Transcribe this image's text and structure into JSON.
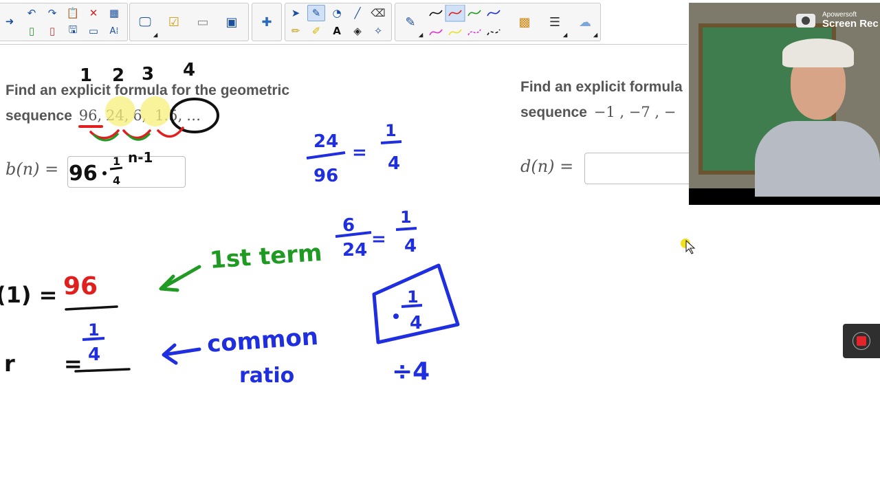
{
  "problem1": {
    "line1": "Find an explicit formula for the geometric",
    "line2_prefix": "sequence",
    "terms": [
      "96",
      "24",
      "6",
      "1.5"
    ],
    "separator": ",",
    "ellipsis": "…",
    "answer_label": "b(n) ="
  },
  "problem2": {
    "line1": "Find an explicit formula",
    "line2_prefix": "sequence",
    "terms_text": "−1 , −7 , −",
    "answer_label": "d(n) ="
  },
  "handwriting": {
    "term_indices": [
      "1",
      "2",
      "3",
      "4"
    ],
    "answer_ink": "96",
    "first_term_lhs": "(1) =",
    "first_term_value": "96",
    "first_term_note": "1st term",
    "ratio_lhs": "r =",
    "ratio_note_1": "common",
    "ratio_note_2": "ratio",
    "divide_note": "÷4"
  },
  "overlay": {
    "brand_line1": "Apowersoft",
    "brand_line2": "Screen Rec"
  },
  "toolbar_icons": {
    "group1": [
      "arrow-right-icon",
      "undo-icon",
      "redo-icon",
      "paste-icon",
      "delete-icon",
      "table-icon",
      "new-page-icon",
      "remove-page-icon",
      "save-icon",
      "screen-icon",
      "text-spell-icon"
    ],
    "group2": [
      "presentation-icon",
      "checklist-icon",
      "capture-icon",
      "lego-icon"
    ],
    "group3": [
      "plugin-icon"
    ],
    "group4": [
      "select-icon",
      "pen-icon",
      "shape-icon",
      "line-icon",
      "eraser-icon",
      "pencil-icon",
      "highlighter-icon",
      "text-tool-icon",
      "fill-icon",
      "magic-wand-icon"
    ],
    "group5": [
      "pen-settings-icon",
      "color-grid-icon",
      "line-style-icon",
      "cloud-icon"
    ]
  },
  "colors": {
    "ink_black": "#111111",
    "ink_red": "#e0201f",
    "ink_green": "#1f9a22",
    "ink_blue": "#1f2fe0",
    "highlight_yellow": "#f7f07a",
    "toolbar_icon": "#1b4f9c"
  }
}
